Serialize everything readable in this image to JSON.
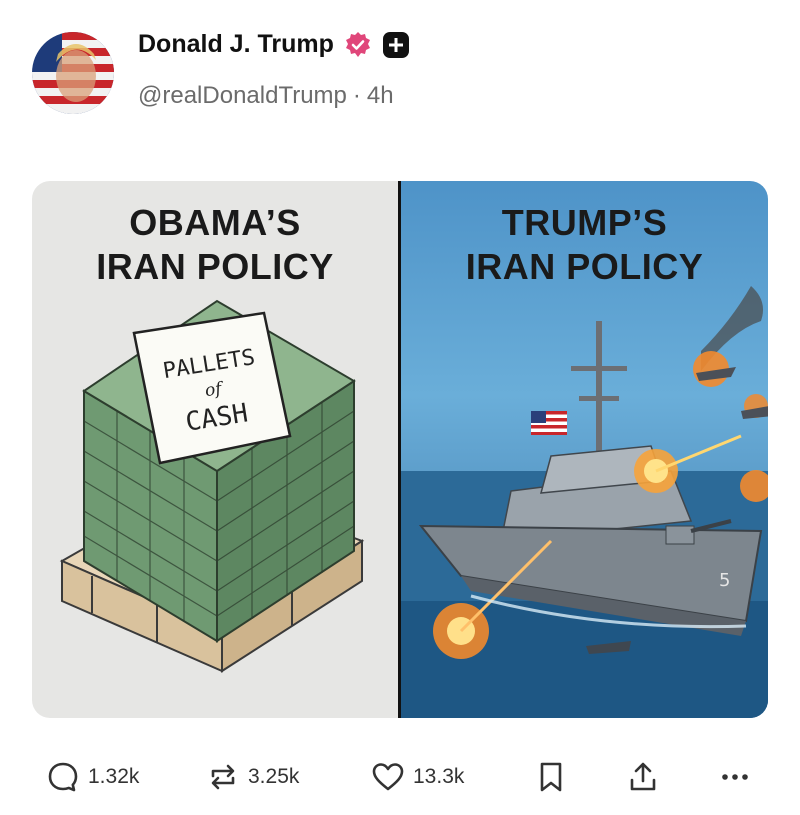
{
  "post": {
    "display_name": "Donald J. Trump",
    "handle": "@realDonaldTrump",
    "separator": "·",
    "time_ago": "4h"
  },
  "media": {
    "left_title_line1": "OBAMA’S",
    "left_title_line2": "IRAN POLICY",
    "note_line1": "PALLETS",
    "note_line2": "of",
    "note_line3": "CASH",
    "right_title_line1": "TRUMP’S",
    "right_title_line2": "IRAN POLICY",
    "hull_number": "5"
  },
  "actions": {
    "replies": "1.32k",
    "reposts": "3.25k",
    "likes": "13.3k"
  },
  "colors": {
    "verified_badge": "#e0467a",
    "left_panel_bg": "#e6e6e4",
    "sky": "#5d9ecb",
    "sea": "#1d4f7a",
    "cash_green": "#6f9a72"
  },
  "icons": {
    "reply": "reply-icon",
    "repost": "repost-icon",
    "like": "heart-icon",
    "bookmark": "bookmark-icon",
    "share": "share-icon",
    "more": "more-icon"
  }
}
